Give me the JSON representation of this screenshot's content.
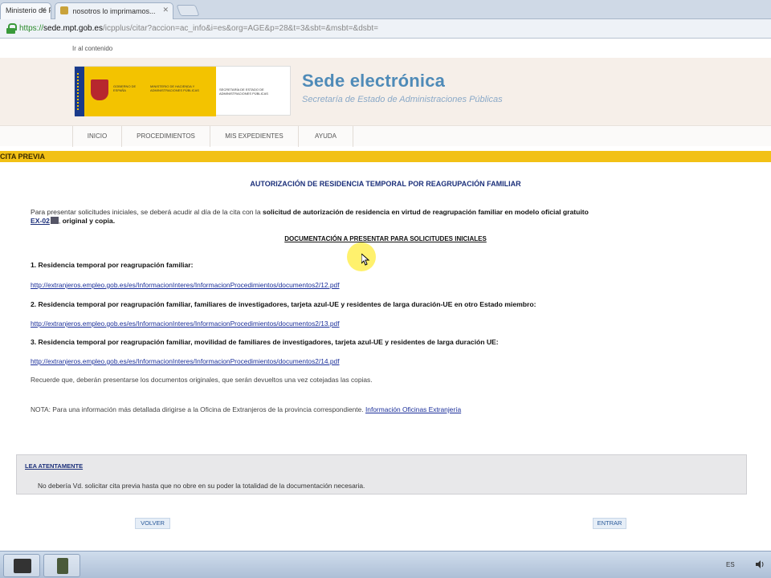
{
  "browser": {
    "tabs": [
      {
        "label": "Ministerio de Política..."
      },
      {
        "label": "nosotros lo imprimamos..."
      }
    ],
    "url": {
      "scheme": "https://",
      "host": "sede.mpt.gob.es",
      "path": "/icpplus/citar?accion=ac_info&i=es&org=AGE&p=28&t=3&sbt=&msbt=&dsbt="
    }
  },
  "page": {
    "skip_link": "Ir al contenido",
    "logo": {
      "gov_text": "GOBIERNO DE ESPAÑA",
      "ministry_text": "MINISTERIO DE HACIENDA Y ADMINISTRACIONES PÚBLICAS",
      "secretary_text": "SECRETARÍA DE ESTADO DE ADMINISTRACIONES PÚBLICAS"
    },
    "site_title": "Sede electrónica",
    "site_subtitle": "Secretaría de Estado de Administraciones Públicas",
    "nav": [
      {
        "label": "INICIO"
      },
      {
        "label": "PROCEDIMIENTOS"
      },
      {
        "label": "MIS EXPEDIENTES"
      },
      {
        "label": "AYUDA"
      }
    ],
    "section_bar": "CITA PREVIA",
    "doc_title": "AUTORIZACIÓN DE RESIDENCIA TEMPORAL POR REAGRUPACIÓN FAMILIAR",
    "intro": {
      "prefix": "Para presentar solicitudes iniciales, se deberá acudir al día de la cita con la",
      "bold": "solicitud de autorización de residencia en virtud de reagrupación familiar en modelo oficial gratuito",
      "form_link": "EX-02",
      "suffix": "original y copia."
    },
    "docs_title": "DOCUMENTACIÓN A PRESENTAR PARA SOLICITUDES INICIALES",
    "items": [
      {
        "title": "1. Residencia temporal por reagrupación familiar:",
        "link": "http://extranjeros.empleo.gob.es/es/InformacionInteres/InformacionProcedimientos/documentos2/12.pdf"
      },
      {
        "title": "2. Residencia temporal por reagrupación familiar, familiares de investigadores, tarjeta azul-UE y residentes de larga duración-UE en otro Estado miembro:",
        "link": "http://extranjeros.empleo.gob.es/es/InformacionInteres/InformacionProcedimientos/documentos2/13.pdf"
      },
      {
        "title": "3. Residencia temporal por reagrupación familiar, movilidad de familiares de investigadores, tarjeta azul-UE y residentes de larga duración UE:",
        "link": "http://extranjeros.empleo.gob.es/es/InformacionInteres/InformacionProcedimientos/documentos2/14.pdf"
      }
    ],
    "reminder": "Recuerde que, deberán presentarse los documentos originales, que serán devueltos una vez cotejadas las copias.",
    "note": {
      "text": "NOTA: Para una información más detallada dirigirse a la Oficina de Extranjeros de la provincia correspondiente.",
      "link": "Información Oficinas Extranjería"
    },
    "notice": {
      "title": "LEA ATENTAMENTE",
      "text": "No debería Vd. solicitar cita previa hasta que no obre en su poder la totalidad de la documentación necesaria."
    },
    "buttons": {
      "back": "VOLVER",
      "enter": "ENTRAR"
    }
  },
  "taskbar": {
    "language": "ES"
  },
  "colors": {
    "accent_yellow": "#f2c116",
    "title_blue": "#4f8bb8",
    "link_blue": "#1b2f9a"
  }
}
